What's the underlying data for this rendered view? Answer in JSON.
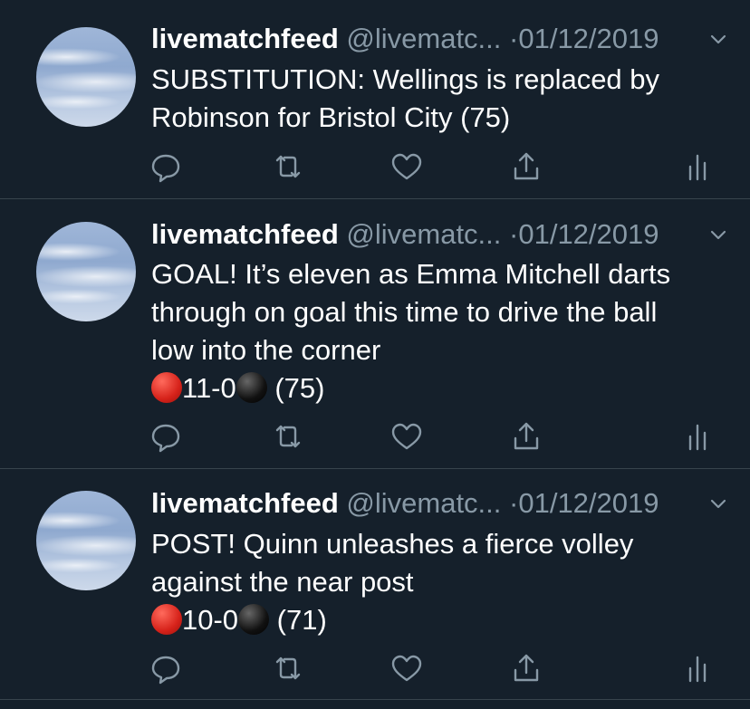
{
  "tweets": [
    {
      "name": "livematchfeed",
      "handle": "@livematc...",
      "dot": "·",
      "date": "01/12/2019",
      "lines": [
        "SUBSTITUTION: Wellings is replaced by",
        "Robinson for Bristol City (75)"
      ],
      "score": null
    },
    {
      "name": "livematchfeed",
      "handle": "@livematc...",
      "dot": "·",
      "date": "01/12/2019",
      "lines": [
        "GOAL! It’s eleven as Emma Mitchell darts",
        "through on goal this time to drive the ball",
        "low into the corner"
      ],
      "score": {
        "text": "11-0",
        "minute": " (75)"
      }
    },
    {
      "name": "livematchfeed",
      "handle": "@livematc...",
      "dot": "·",
      "date": "01/12/2019",
      "lines": [
        "POST! Quinn unleashes a fierce volley",
        "against the near post"
      ],
      "score": {
        "text": "10-0",
        "minute": " (71)"
      }
    }
  ],
  "icons": [
    "reply-icon",
    "retweet-icon",
    "like-icon",
    "share-icon",
    "analytics-icon",
    "chevron-down-icon"
  ],
  "colors": {
    "background": "#15202b",
    "secondary_text": "#8899a6",
    "divider": "#38444d",
    "red_ball": "#d6221a",
    "black_ball": "#000000"
  }
}
